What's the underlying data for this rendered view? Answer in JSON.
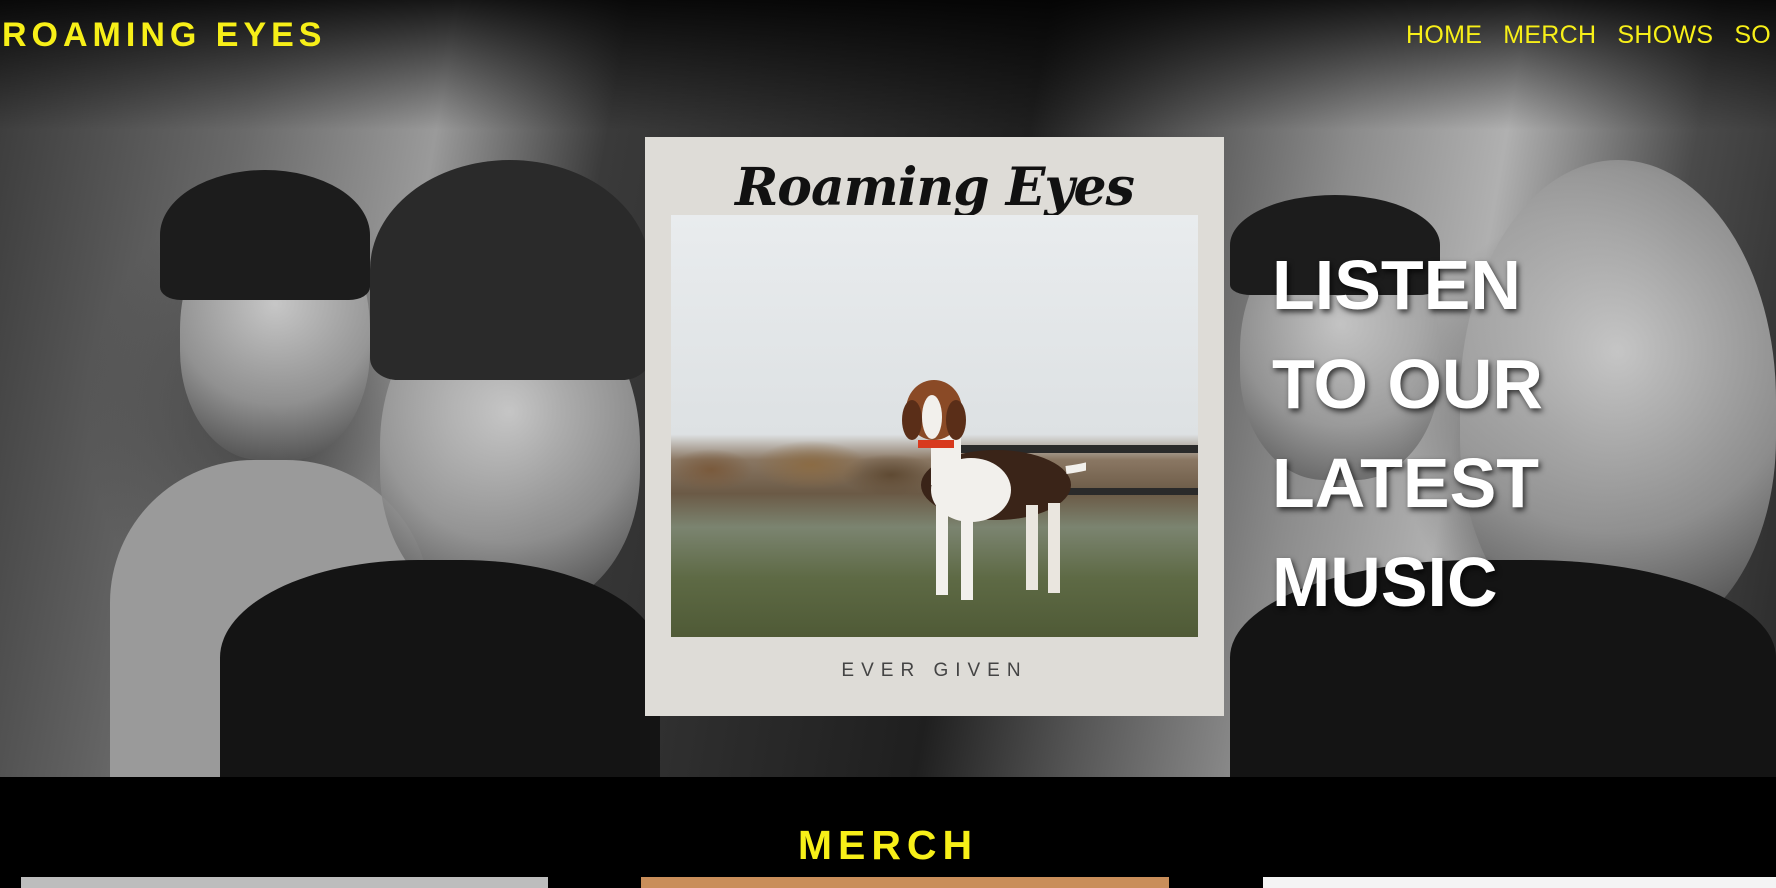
{
  "brand": {
    "name": "ROAMING EYES"
  },
  "nav": {
    "items": [
      {
        "label": "HOME"
      },
      {
        "label": "MERCH"
      },
      {
        "label": "SHOWS"
      },
      {
        "label": "SO"
      }
    ]
  },
  "hero": {
    "album": {
      "logo_text": "Roaming Eyes",
      "title": "EVER GIVEN"
    },
    "headline_lines": [
      "LISTEN",
      "TO OUR",
      "LATEST",
      "MUSIC"
    ]
  },
  "merch": {
    "title": "MERCH"
  },
  "colors": {
    "accent": "#f7ef18",
    "background": "#000000",
    "album_bg": "#dedcd7"
  }
}
